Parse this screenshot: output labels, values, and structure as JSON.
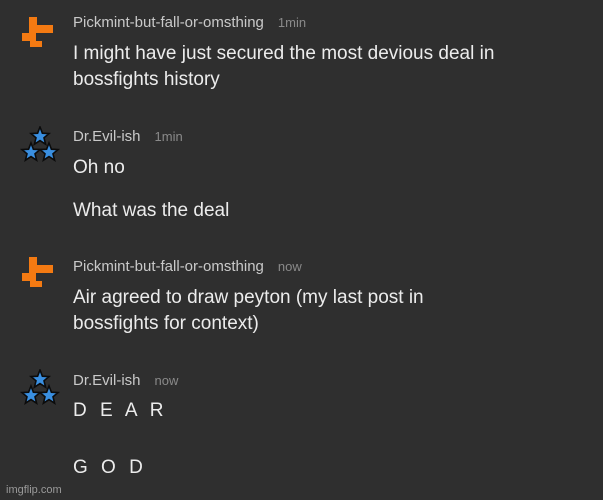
{
  "messages": [
    {
      "user": "Pickmint-but-fall-or-omsthing",
      "time": "1min",
      "lines": [
        "I might have just secured the most devious deal in",
        "bossfights history"
      ]
    },
    {
      "user": "Dr.Evil-ish",
      "time": "1min",
      "lines": [
        "Oh no",
        "What was the deal"
      ]
    },
    {
      "user": "Pickmint-but-fall-or-omsthing",
      "time": "now",
      "lines": [
        "Air agreed to draw peyton (my last post in",
        "bossfights for context)"
      ]
    },
    {
      "user": "Dr.Evil-ish",
      "time": "now",
      "lines": [
        "D E A R",
        "G O D"
      ]
    }
  ],
  "watermark": "imgflip.com",
  "colors": {
    "background": "#2f2f2f",
    "orange_avatar": "#f47a12",
    "star_blue": "#3a8fe0"
  }
}
